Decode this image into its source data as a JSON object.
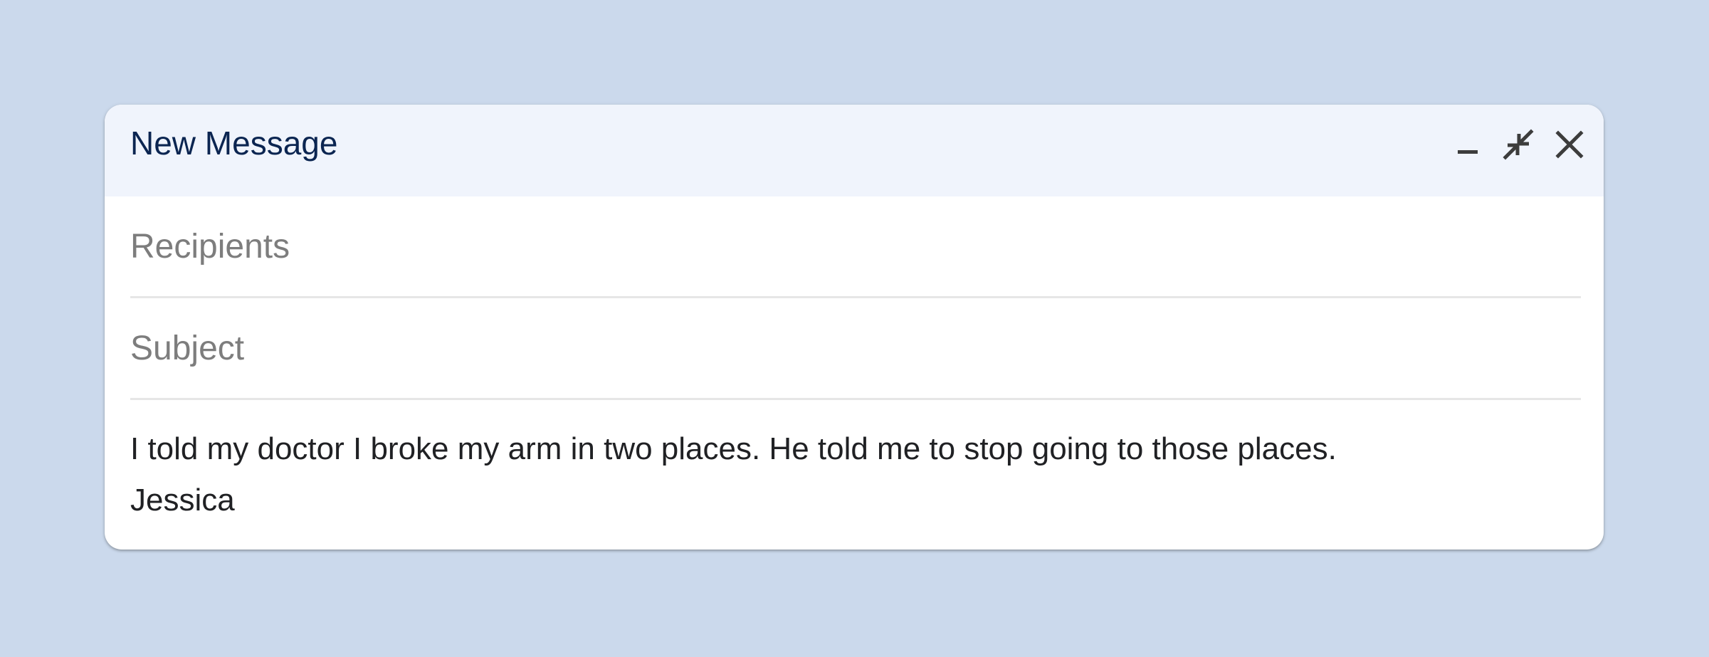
{
  "compose": {
    "title": "New Message",
    "header_icons": [
      "minimize-icon",
      "exit-fullscreen-icon",
      "close-icon"
    ],
    "recipients": {
      "placeholder": "Recipients",
      "value": ""
    },
    "subject": {
      "placeholder": "Subject",
      "value": ""
    },
    "body": {
      "lines": [
        "I told my doctor I broke my arm in two places. He told me to stop going to those places.",
        "Jessica"
      ]
    }
  },
  "colors": {
    "page_background": "#cbd9ec",
    "header_background": "#f0f4fc",
    "title_text": "#0b2551",
    "body_text": "#202124",
    "placeholder_text": "#7d7d7d"
  }
}
